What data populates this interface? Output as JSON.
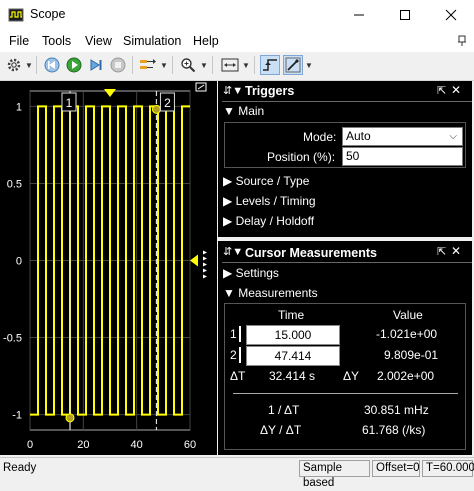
{
  "window": {
    "title": "Scope"
  },
  "menu": {
    "items": [
      "File",
      "Tools",
      "View",
      "Simulation",
      "Help"
    ]
  },
  "plot": {
    "y_ticks": [
      "1",
      "0.5",
      "0",
      "-0.5",
      "-1"
    ],
    "x_ticks": [
      "0",
      "20",
      "40",
      "60"
    ],
    "cursor1_label": "1",
    "cursor2_label": "2",
    "signal_color": "#ffff00"
  },
  "chart_data": {
    "type": "line",
    "xlim": [
      0,
      60
    ],
    "ylim": [
      -1.1,
      1.1
    ],
    "grid": true,
    "series": [
      {
        "x": [
          0,
          3,
          3,
          6,
          6,
          9,
          9,
          12,
          12,
          15,
          15,
          18,
          18,
          21,
          21,
          24,
          24,
          27,
          27,
          30,
          30,
          33,
          33,
          36,
          36,
          39,
          39,
          42,
          42,
          45,
          45,
          48,
          48,
          51,
          51,
          54,
          54,
          57,
          57,
          60
        ],
        "y": [
          -1,
          -1,
          1,
          1,
          -1,
          -1,
          1,
          1,
          -1,
          -1,
          1,
          1,
          -1,
          -1,
          1,
          1,
          -1,
          -1,
          1,
          1,
          -1,
          -1,
          1,
          1,
          -1,
          -1,
          1,
          1,
          -1,
          -1,
          1,
          1,
          -1,
          -1,
          1,
          1,
          -1,
          -1,
          1,
          1
        ]
      }
    ],
    "cursors": [
      {
        "x": 15.0,
        "y": -1.021
      },
      {
        "x": 47.414,
        "y": 0.9809
      }
    ]
  },
  "triggers": {
    "title": "Triggers",
    "main_section": "Main",
    "mode_label": "Mode:",
    "mode_value": "Auto",
    "position_label": "Position (%):",
    "position_value": "50",
    "sections": [
      "Source / Type",
      "Levels / Timing",
      "Delay / Holdoff"
    ]
  },
  "cursor_measurements": {
    "title": "Cursor Measurements",
    "settings_section": "Settings",
    "measurements_section": "Measurements",
    "col_time": "Time",
    "col_value": "Value",
    "rows": [
      {
        "label": "1",
        "time": "15.000",
        "value": "-1.021e+00"
      },
      {
        "label": "2",
        "time": "47.414",
        "value": "9.809e-01"
      }
    ],
    "delta_t_label": "ΔT",
    "delta_t_value": "32.414 s",
    "delta_y_label": "ΔY",
    "delta_y_value": "2.002e+00",
    "inv_dt_label": "1 / ΔT",
    "inv_dt_value": "30.851 mHz",
    "dy_dt_label": "ΔY / ΔT",
    "dy_dt_value": "61.768 (/ks)"
  },
  "status": {
    "left": "Ready",
    "sample": "Sample based",
    "offset": "Offset=0",
    "time": "T=60.000"
  }
}
